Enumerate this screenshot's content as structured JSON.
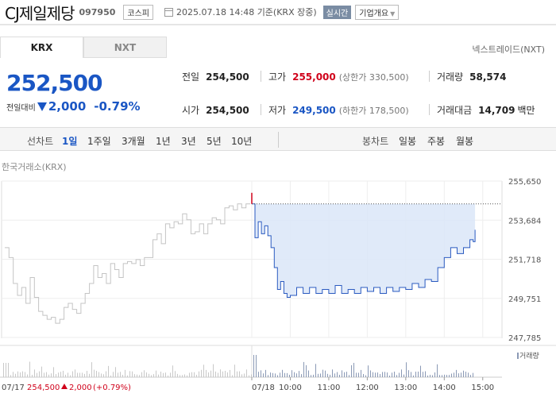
{
  "header": {
    "title": "CJ제일제당",
    "code": "097950",
    "market": "코스피",
    "datetime": "2025.07.18 14:48 기준(KRX 장중)",
    "realtime": "실시간",
    "company_btn": "기업개요"
  },
  "market_tabs": [
    "KRX",
    "NXT"
  ],
  "next_link": "넥스트레이드(NXT)",
  "price": {
    "current": "252,500",
    "compare_label": "전일대비",
    "change": "2,000",
    "change_pct": "-0.79%",
    "direction": "down",
    "color": "#1a56c4"
  },
  "stats": {
    "prev_close": {
      "label": "전일",
      "value": "254,500"
    },
    "open": {
      "label": "시가",
      "value": "254,500"
    },
    "high": {
      "label": "고가",
      "value": "255,000",
      "sub": "(상한가 330,500)"
    },
    "low": {
      "label": "저가",
      "value": "249,500",
      "sub": "(하한가 178,500)"
    },
    "volume": {
      "label": "거래량",
      "value": "58,574"
    },
    "amount": {
      "label": "거래대금",
      "value": "14,709",
      "unit": "백만"
    }
  },
  "period_bar": {
    "line_label": "선차트",
    "line_periods": [
      "1일",
      "1주일",
      "3개월",
      "1년",
      "3년",
      "5년",
      "10년"
    ],
    "active": "1일",
    "candle_label": "봉차트",
    "candle_periods": [
      "일봉",
      "주봉",
      "월봉"
    ]
  },
  "exchange_label": "한국거래소(KRX)",
  "chart_data": {
    "type": "line",
    "y_ticks": [
      "255,650",
      "253,684",
      "251,718",
      "249,751",
      "247,785"
    ],
    "ylim": [
      247785,
      255650
    ],
    "x_ticks": [
      "07/18",
      "10:00",
      "11:00",
      "12:00",
      "13:00",
      "14:00",
      "15:00"
    ],
    "prev_close_ref": 254500,
    "volume_label": "거래량",
    "prev_day": {
      "date": "07/17",
      "close": "254,500",
      "change": "2,000",
      "pct": "(+0.79%)",
      "values": [
        252300,
        251800,
        250500,
        249900,
        250300,
        249500,
        250800,
        249800,
        249100,
        248900,
        248700,
        248800,
        248500,
        248700,
        249300,
        249500,
        249200,
        249000,
        249500,
        250000,
        250500,
        251400,
        250800,
        251000,
        250500,
        251500,
        251200,
        250800,
        251500,
        251600,
        251500,
        251700,
        251400,
        251800,
        251800,
        252700,
        253000,
        252500,
        253500,
        253300,
        253600,
        253500,
        254000,
        253700,
        253000,
        253100,
        253500,
        253000,
        253500,
        253800,
        253700,
        253500,
        254300,
        254400,
        254200,
        254500,
        254300,
        254500,
        254500
      ]
    },
    "today": {
      "color": "#2a5ac0",
      "fill": "#dbe6f8",
      "times": [
        "09:00",
        "09:05",
        "09:10",
        "09:15",
        "09:20",
        "09:25",
        "09:30",
        "09:35",
        "09:40",
        "09:45",
        "09:50",
        "09:55",
        "10:00",
        "10:10",
        "10:20",
        "10:30",
        "10:40",
        "10:50",
        "11:00",
        "11:10",
        "11:20",
        "11:30",
        "11:40",
        "11:50",
        "12:00",
        "12:10",
        "12:20",
        "12:30",
        "12:40",
        "12:50",
        "13:00",
        "13:10",
        "13:20",
        "13:30",
        "13:40",
        "13:50",
        "14:00",
        "14:10",
        "14:20",
        "14:30",
        "14:40",
        "14:45",
        "14:48"
      ],
      "values": [
        254500,
        252800,
        253600,
        253000,
        253400,
        252900,
        252300,
        251300,
        250200,
        250600,
        250000,
        249800,
        249900,
        250300,
        250000,
        250300,
        250000,
        250200,
        250000,
        250400,
        250000,
        250200,
        250000,
        250300,
        250100,
        250300,
        250000,
        250300,
        250100,
        250300,
        250200,
        250500,
        250300,
        250700,
        250600,
        251300,
        251800,
        252300,
        252000,
        252300,
        252700,
        252600,
        253200
      ]
    }
  }
}
